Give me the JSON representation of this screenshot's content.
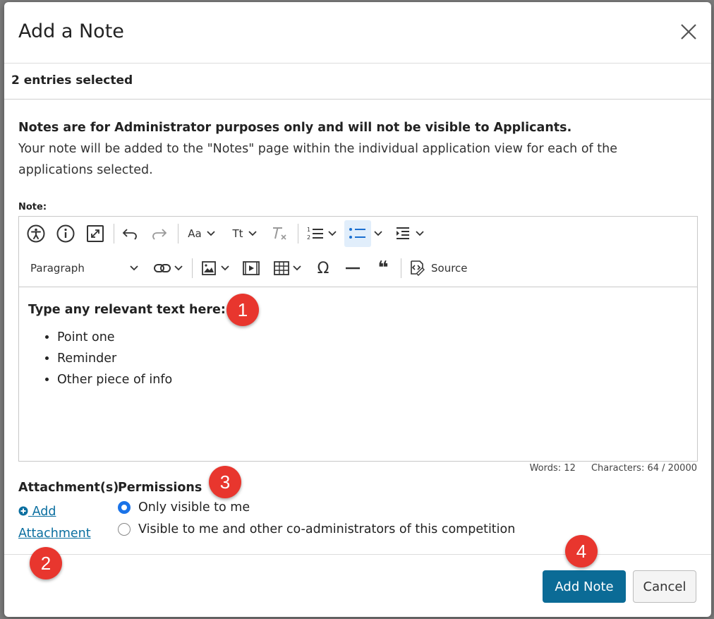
{
  "modal": {
    "title": "Add a Note",
    "selection_text": "2 entries selected",
    "info_bold": "Notes are for Administrator purposes only and will not be visible to Applicants.",
    "info_text": "Your note will be added to the \"Notes\" page within the individual application view for each of the applications selected.",
    "note_label": "Note:"
  },
  "editor": {
    "toolbar": {
      "font_size_label": "Aa",
      "heading_label": "Tt",
      "paragraph_label": "Paragraph",
      "source_label": "Source",
      "omega_label": "Ω",
      "quote_label": "❝"
    },
    "content": {
      "heading": "Type any relevant text here:",
      "bullets": [
        "Point one",
        "Reminder",
        "Other piece of info"
      ]
    },
    "words_label": "Words: 12",
    "characters_label": "Characters: 64 / 20000"
  },
  "attachments": {
    "heading": "Attachment(s)",
    "add_label_1": "Add",
    "add_label_2": "Attachment"
  },
  "permissions": {
    "heading": "Permissions",
    "options": [
      {
        "label": "Only visible to me",
        "selected": true
      },
      {
        "label": "Visible to me and other co-administrators of this competition",
        "selected": false
      }
    ]
  },
  "footer": {
    "add_note_label": "Add Note",
    "cancel_label": "Cancel"
  },
  "annotations": [
    "1",
    "2",
    "3",
    "4"
  ],
  "colors": {
    "primary": "#0b6b96",
    "link": "#0b6fa0",
    "badge": "#e8362e",
    "radio_selected": "#1a73e8"
  }
}
